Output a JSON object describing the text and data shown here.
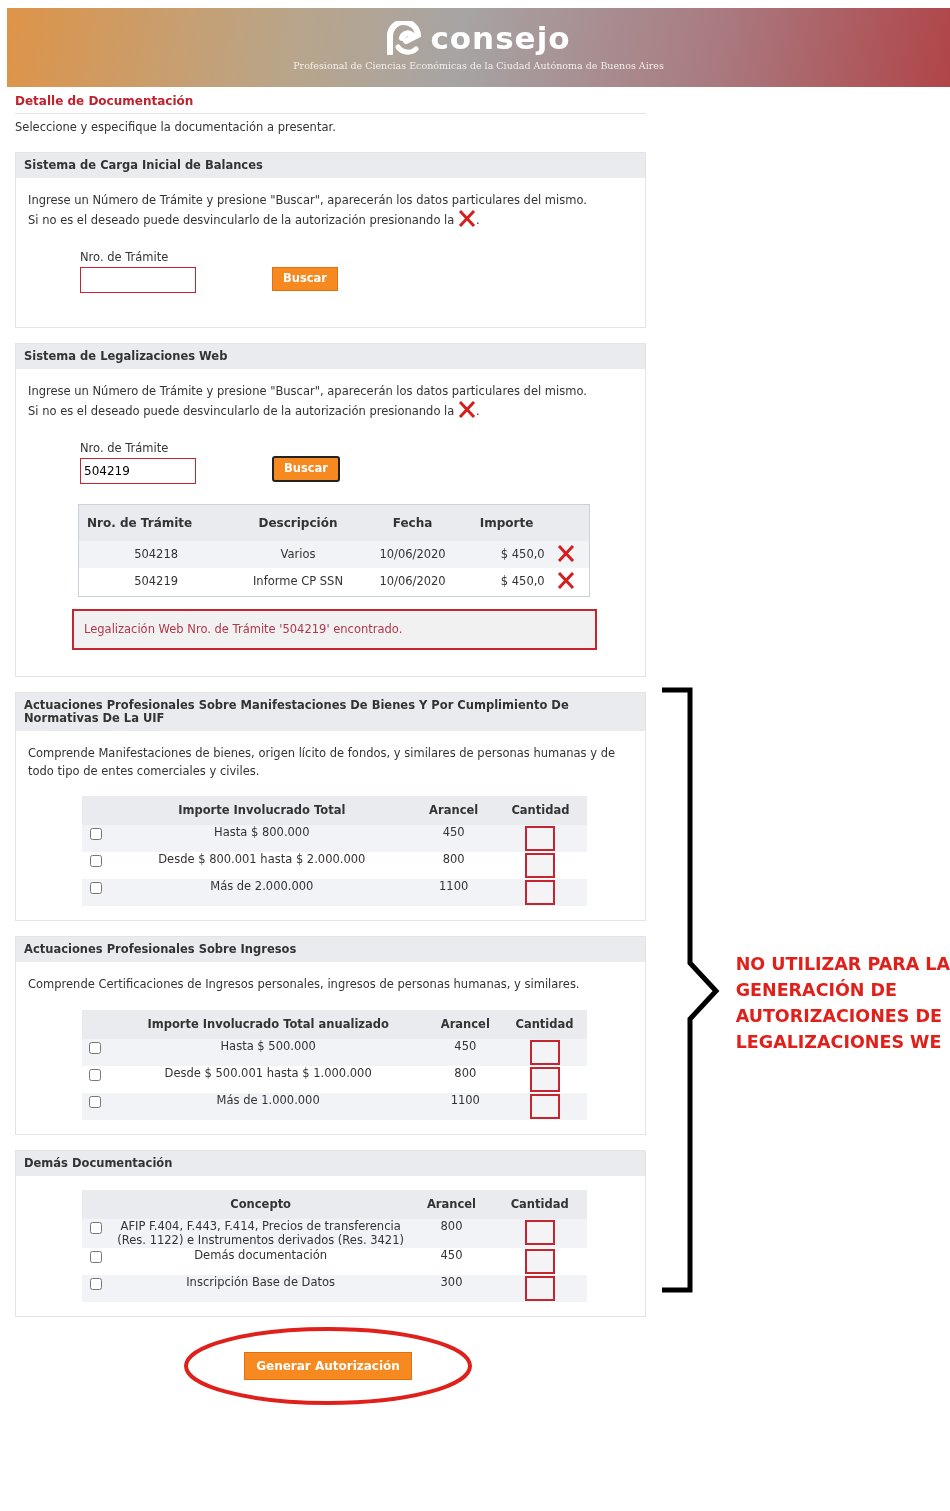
{
  "header": {
    "brand": "consejo",
    "subtitle": "Profesional de Ciencias Económicas de la Ciudad Autónoma de Buenos Aires"
  },
  "page_title": "Detalle de Documentación",
  "intro": "Seleccione y especifique la documentación a presentar.",
  "sections": [
    {
      "kind": "lookup",
      "title": "Sistema de Carga Inicial de Balances",
      "instructions": [
        "Ingrese un Número de Trámite y presione \"Buscar\", aparecerán los datos particulares del mismo.",
        "Si no es el deseado puede desvincularlo de la autorización presionando la"
      ],
      "instructions_end": ".",
      "field_label": "Nro. de Trámite",
      "button": {
        "label": "Buscar",
        "focused": false
      }
    },
    {
      "kind": "lookup",
      "title": "Sistema de Legalizaciones Web",
      "instructions": [
        "Ingrese un Número de Trámite y presione \"Buscar\", aparecerán los datos particulares del mismo.",
        "Si no es el deseado puede desvincularlo de la autorización presionando la"
      ],
      "instructions_end": ".",
      "field_label": "Nro. de Trámite",
      "value": "504219",
      "button": {
        "label": "Buscar",
        "focused": true
      },
      "results": {
        "columns": [
          "Nro. de Trámite",
          "Descripción",
          "Fecha",
          "Importe"
        ],
        "rows": [
          {
            "number": "504218",
            "description": "Varios",
            "date": "10/06/2020",
            "amount": "$ 450,0"
          },
          {
            "number": "504219",
            "description": "Informe CP SSN",
            "date": "10/06/2020",
            "amount": "$ 450,0"
          }
        ]
      },
      "message": "Legalización Web Nro. de Trámite '504219' encontrado."
    },
    {
      "kind": "fees",
      "title": "Actuaciones Profesionales Sobre Manifestaciones De Bienes Y Por Cumplimiento De Normativas De La UIF",
      "description": "Comprende Manifestaciones de bienes, origen lícito de fondos, y similares de personas humanas y de todo tipo de entes comerciales y civiles.",
      "columns": [
        "Importe Involucrado Total",
        "Arancel",
        "Cantidad"
      ],
      "rows": [
        {
          "concept": "Hasta $ 800.000",
          "fee": "450",
          "checked": false
        },
        {
          "concept": "Desde $ 800.001 hasta $ 2.000.000",
          "fee": "800",
          "checked": false
        },
        {
          "concept": "Más de 2.000.000",
          "fee": "1100",
          "checked": false
        }
      ]
    },
    {
      "kind": "fees",
      "title": "Actuaciones Profesionales Sobre Ingresos",
      "description": "Comprende Certificaciones de Ingresos personales, ingresos de personas humanas, y similares.",
      "columns": [
        "Importe Involucrado Total anualizado",
        "Arancel",
        "Cantidad"
      ],
      "rows": [
        {
          "concept": "Hasta $ 500.000",
          "fee": "450",
          "checked": false
        },
        {
          "concept": "Desde $ 500.001 hasta $ 1.000.000",
          "fee": "800",
          "checked": false
        },
        {
          "concept": "Más de 1.000.000",
          "fee": "1100",
          "checked": false
        }
      ]
    },
    {
      "kind": "fees",
      "title": "Demás Documentación",
      "columns": [
        "Concepto",
        "Arancel",
        "Cantidad"
      ],
      "rows": [
        {
          "concept": "AFIP F.404, F.443, F.414, Precios de transferencia (Res. 1122) e Instrumentos derivados (Res. 3421)",
          "fee": "800",
          "checked": false
        },
        {
          "concept": "Demás documentación",
          "fee": "450",
          "checked": false
        },
        {
          "concept": "Inscripción Base de Datos",
          "fee": "300",
          "checked": false
        }
      ]
    }
  ],
  "submit_button": "Generar Autorización",
  "annotation": [
    "NO UTILIZAR PARA LA",
    "GENERACIÓN DE",
    "AUTORIZACIONES DE",
    "LEGALIZACIONES WE"
  ]
}
